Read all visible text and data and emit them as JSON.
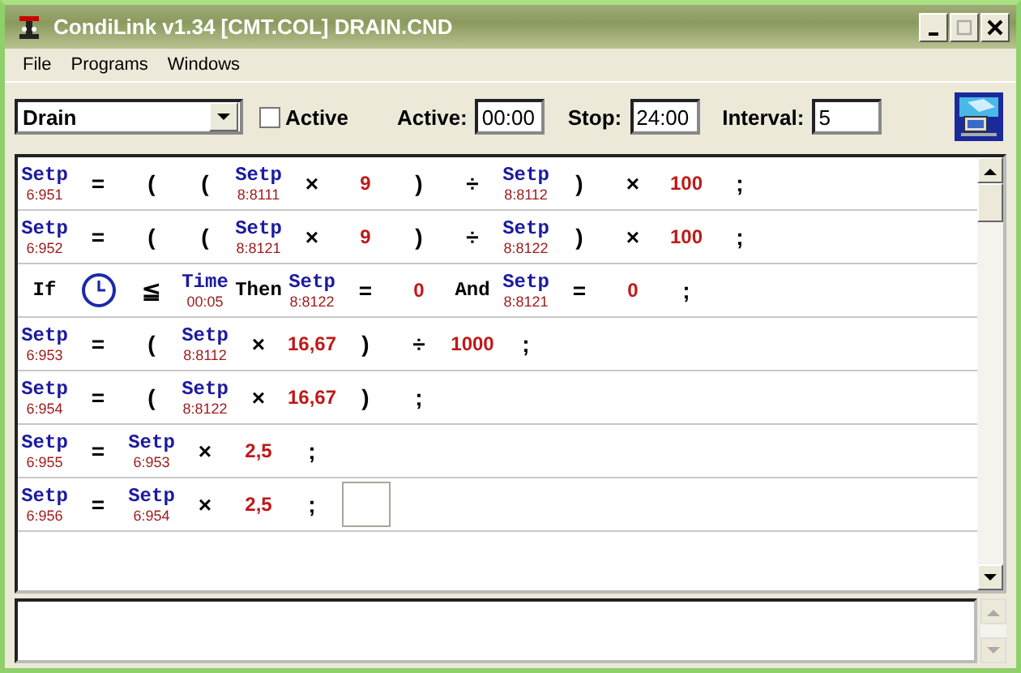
{
  "window": {
    "title": "CondiLink v1.34 [CMT.COL] DRAIN.CND"
  },
  "menu": [
    "File",
    "Programs",
    "Windows"
  ],
  "toolbar": {
    "program": "Drain",
    "active_checkbox": {
      "label": "Active",
      "checked": false
    },
    "fields": [
      {
        "label": "Active:",
        "value": "00:00"
      },
      {
        "label": "Stop:",
        "value": "24:00"
      },
      {
        "label": "Interval:",
        "value": "5"
      }
    ]
  },
  "rules": [
    {
      "tokens": [
        {
          "kind": "var",
          "label": "Setp",
          "ref": "6:951"
        },
        {
          "kind": "op",
          "text": "="
        },
        {
          "kind": "op",
          "text": "("
        },
        {
          "kind": "op",
          "text": "("
        },
        {
          "kind": "var",
          "label": "Setp",
          "ref": "8:8111"
        },
        {
          "kind": "op",
          "text": "×"
        },
        {
          "kind": "num",
          "text": "9"
        },
        {
          "kind": "op",
          "text": ")"
        },
        {
          "kind": "op",
          "text": "÷"
        },
        {
          "kind": "var",
          "label": "Setp",
          "ref": "8:8112"
        },
        {
          "kind": "op",
          "text": ")"
        },
        {
          "kind": "op",
          "text": "×"
        },
        {
          "kind": "num",
          "text": "100"
        },
        {
          "kind": "op",
          "text": ";"
        }
      ]
    },
    {
      "tokens": [
        {
          "kind": "var",
          "label": "Setp",
          "ref": "6:952"
        },
        {
          "kind": "op",
          "text": "="
        },
        {
          "kind": "op",
          "text": "("
        },
        {
          "kind": "op",
          "text": "("
        },
        {
          "kind": "var",
          "label": "Setp",
          "ref": "8:8121"
        },
        {
          "kind": "op",
          "text": "×"
        },
        {
          "kind": "num",
          "text": "9"
        },
        {
          "kind": "op",
          "text": ")"
        },
        {
          "kind": "op",
          "text": "÷"
        },
        {
          "kind": "var",
          "label": "Setp",
          "ref": "8:8122"
        },
        {
          "kind": "op",
          "text": ")"
        },
        {
          "kind": "op",
          "text": "×"
        },
        {
          "kind": "num",
          "text": "100"
        },
        {
          "kind": "op",
          "text": ";"
        }
      ]
    },
    {
      "tokens": [
        {
          "kind": "keyword",
          "text": "If"
        },
        {
          "kind": "clock"
        },
        {
          "kind": "op",
          "text": "≦"
        },
        {
          "kind": "var",
          "label": "Time",
          "ref": "00:05"
        },
        {
          "kind": "keyword",
          "text": "Then"
        },
        {
          "kind": "var",
          "label": "Setp",
          "ref": "8:8122"
        },
        {
          "kind": "op",
          "text": "="
        },
        {
          "kind": "num",
          "text": "0"
        },
        {
          "kind": "keyword",
          "text": "And"
        },
        {
          "kind": "var",
          "label": "Setp",
          "ref": "8:8121"
        },
        {
          "kind": "op",
          "text": "="
        },
        {
          "kind": "num",
          "text": "0"
        },
        {
          "kind": "op",
          "text": ";"
        }
      ]
    },
    {
      "tokens": [
        {
          "kind": "var",
          "label": "Setp",
          "ref": "6:953"
        },
        {
          "kind": "op",
          "text": "="
        },
        {
          "kind": "op",
          "text": "("
        },
        {
          "kind": "var",
          "label": "Setp",
          "ref": "8:8112"
        },
        {
          "kind": "op",
          "text": "×"
        },
        {
          "kind": "num",
          "text": "16,67"
        },
        {
          "kind": "op",
          "text": ")"
        },
        {
          "kind": "op",
          "text": "÷"
        },
        {
          "kind": "num",
          "text": "1000"
        },
        {
          "kind": "op",
          "text": ";"
        }
      ]
    },
    {
      "tokens": [
        {
          "kind": "var",
          "label": "Setp",
          "ref": "6:954"
        },
        {
          "kind": "op",
          "text": "="
        },
        {
          "kind": "op",
          "text": "("
        },
        {
          "kind": "var",
          "label": "Setp",
          "ref": "8:8122"
        },
        {
          "kind": "op",
          "text": "×"
        },
        {
          "kind": "num",
          "text": "16,67"
        },
        {
          "kind": "op",
          "text": ")"
        },
        {
          "kind": "op",
          "text": ";"
        }
      ]
    },
    {
      "tokens": [
        {
          "kind": "var",
          "label": "Setp",
          "ref": "6:955"
        },
        {
          "kind": "op",
          "text": "="
        },
        {
          "kind": "var",
          "label": "Setp",
          "ref": "6:953"
        },
        {
          "kind": "op",
          "text": "×"
        },
        {
          "kind": "num",
          "text": "2,5"
        },
        {
          "kind": "op",
          "text": ";"
        }
      ]
    },
    {
      "tokens": [
        {
          "kind": "var",
          "label": "Setp",
          "ref": "6:956"
        },
        {
          "kind": "op",
          "text": "="
        },
        {
          "kind": "var",
          "label": "Setp",
          "ref": "6:954"
        },
        {
          "kind": "op",
          "text": "×"
        },
        {
          "kind": "num",
          "text": "2,5"
        },
        {
          "kind": "op",
          "text": ";"
        },
        {
          "kind": "slot"
        }
      ]
    }
  ]
}
